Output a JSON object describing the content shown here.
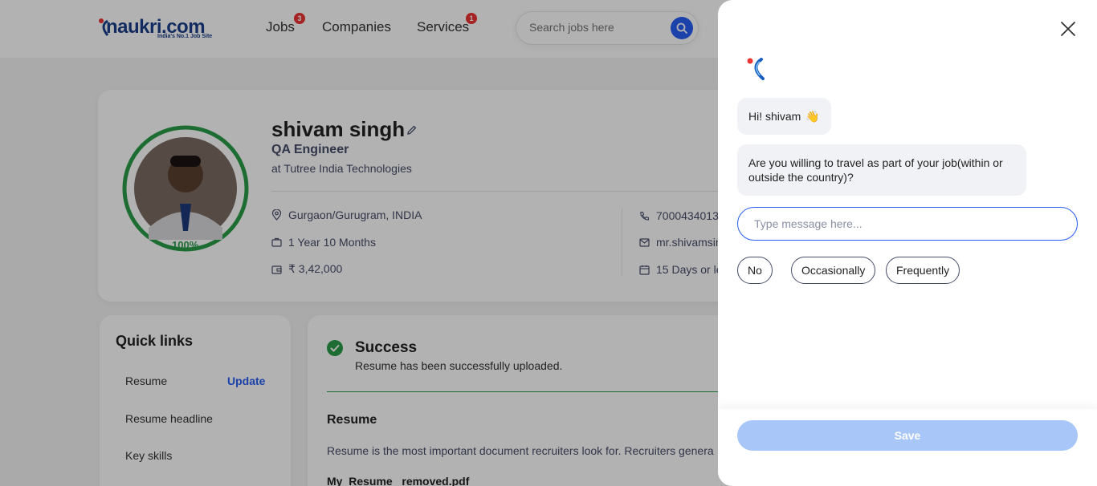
{
  "header": {
    "logo_text": "naukri.com",
    "logo_tagline": "India's No.1 Job Site",
    "nav": [
      {
        "label": "Jobs",
        "badge": "3"
      },
      {
        "label": "Companies",
        "badge": ""
      },
      {
        "label": "Services",
        "badge": "1"
      }
    ],
    "search_placeholder": "Search jobs here"
  },
  "profile": {
    "name": "shivam singh",
    "role": "QA Engineer",
    "company": "at Tutree India Technologies",
    "completion": "100%",
    "completion_fraction": 1.0,
    "location": "Gurgaon/Gurugram, INDIA",
    "experience": "1 Year 10 Months",
    "salary": "₹ 3,42,000",
    "phone": "7000434013",
    "email": "mr.shivamsin",
    "notice": "15 Days or le"
  },
  "quick_links": {
    "title": "Quick links",
    "items": [
      "Resume",
      "Resume headline",
      "Key skills"
    ],
    "update_label": "Update"
  },
  "resume_section": {
    "success_title": "Success",
    "success_message": "Resume has been successfully uploaded.",
    "title": "Resume",
    "description": "Resume is the most important document recruiters look for. Recruiters genera",
    "filename": "My_Resume _removed.pdf"
  },
  "chat": {
    "greeting": "Hi! shivam",
    "greeting_emoji": "👋",
    "question": "Are you willing to travel as part of your job(within or outside the country)?",
    "input_placeholder": "Type message here...",
    "options": [
      "No",
      "Occasionally",
      "Frequently"
    ],
    "save_label": "Save"
  },
  "colors": {
    "brand_blue": "#275df5",
    "success_green": "#2a9d4a",
    "badge_red": "#e33333",
    "save_disabled": "#a8c6f8"
  }
}
